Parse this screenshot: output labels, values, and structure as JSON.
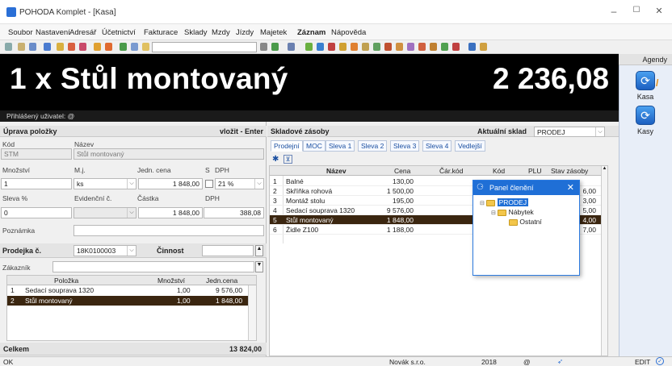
{
  "window": {
    "title": "POHODA Komplet - [Kasa]",
    "min": "–",
    "max": "☐",
    "close": "✕"
  },
  "menu": [
    "Soubor",
    "Nastavení",
    "Adresář",
    "Účetnictví",
    "Fakturace",
    "Sklady",
    "Mzdy",
    "Jízdy",
    "Majetek",
    "Záznam",
    "Nápověda"
  ],
  "agendy": {
    "title": "Agendy",
    "items": [
      {
        "label": "Kasa",
        "icon": "kasa-icon"
      },
      {
        "label": "Kasy",
        "icon": "kasy-icon"
      }
    ]
  },
  "display": {
    "item": "1 x  Stůl montovaný",
    "price": "2 236,08"
  },
  "user": "Přihlášený uživatel: @",
  "edit": {
    "header": "Úprava položky",
    "insert": "vložit - Enter",
    "kod_label": "Kód",
    "nazev_label": "Název",
    "kod": "STM",
    "nazev": "Stůl montovaný",
    "mnozstvi_label": "Množství",
    "mj_label": "M.j.",
    "cena_label": "Jedn. cena",
    "s_label": "S",
    "dph_label": "DPH",
    "mnozstvi": "1",
    "mj": "ks",
    "cena": "1 848,00",
    "dph": "21 %",
    "sleva_label": "Sleva %",
    "evid_label": "Evidenční č.",
    "castka_label": "Částka",
    "dph2_label": "DPH",
    "sleva": "0",
    "castka": "1 848,00",
    "dph_value": "388,08",
    "poznamka_label": "Poznámka"
  },
  "receipt": {
    "prodejka_label": "Prodejka č.",
    "prodejka": "18K0100003",
    "cinnost_label": "Činnost",
    "zakaznik_label": "Zákazník",
    "columns": [
      "Položka",
      "Množství",
      "Jedn.cena"
    ],
    "rows": [
      {
        "n": "1",
        "item": "Sedací souprava 1320",
        "qty": "1,00",
        "price": "9 576,00"
      },
      {
        "n": "2",
        "item": "Stůl montovaný",
        "qty": "1,00",
        "price": "1 848,00"
      }
    ],
    "total_label": "Celkem",
    "total": "13 824,00"
  },
  "stock": {
    "header": "Skladové zásoby",
    "sklad_label": "Aktuální sklad",
    "sklad": "PRODEJ",
    "tabs": [
      "Prodejní",
      "MOC",
      "Sleva 1",
      "Sleva 2",
      "Sleva 3",
      "Sleva 4",
      "Vedlejší"
    ],
    "columns": [
      "Název",
      "Cena",
      "Čár.kód",
      "Kód",
      "PLU",
      "Stav zásoby"
    ],
    "rows": [
      {
        "n": "1",
        "name": "Balné",
        "price": "130,00",
        "stock": ""
      },
      {
        "n": "2",
        "name": "Skříňka rohová",
        "price": "1 500,00",
        "stock": "6,00"
      },
      {
        "n": "3",
        "name": "Montáž stolu",
        "price": "195,00",
        "stock": "3,00"
      },
      {
        "n": "4",
        "name": "Sedací souprava 1320",
        "price": "9 576,00",
        "stock": "5,00"
      },
      {
        "n": "5",
        "name": "Stůl montovaný",
        "price": "1 848,00",
        "stock": "4,00"
      },
      {
        "n": "6",
        "name": "Židle Z100",
        "price": "1 188,00",
        "stock": "7,00"
      }
    ]
  },
  "panel": {
    "title": "Panel členění",
    "root": "PRODEJ",
    "child": "Nábytek",
    "grandchild": "Ostatní"
  },
  "status": {
    "left": "OK",
    "company": "Novák s.r.o.",
    "year": "2018",
    "at": "@",
    "mode": "EDIT"
  }
}
